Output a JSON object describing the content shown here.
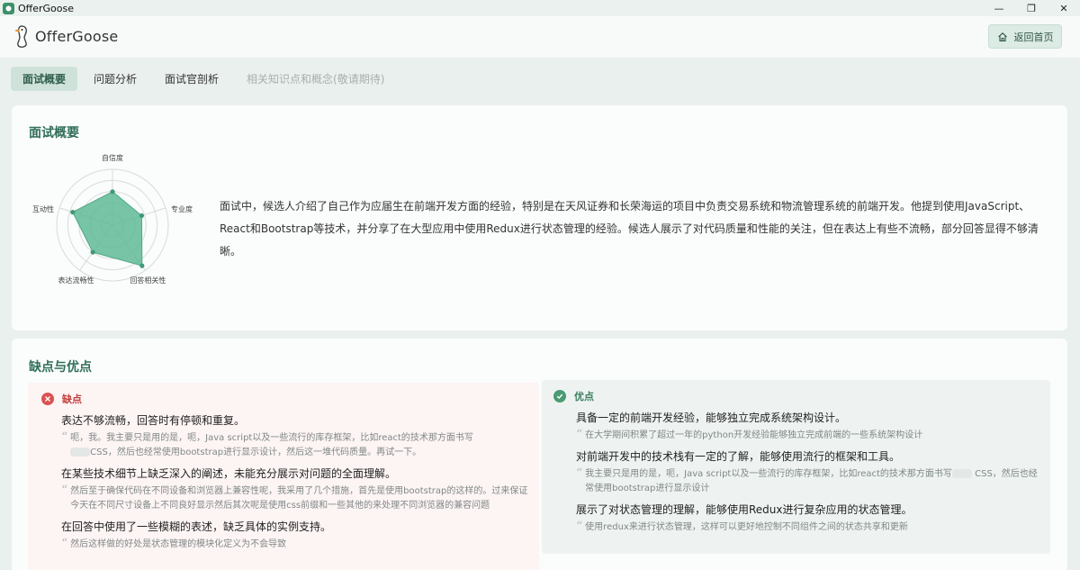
{
  "window": {
    "title": "OfferGoose",
    "controls": {
      "minimize": "—",
      "maximize": "❐",
      "close": "✕"
    }
  },
  "header": {
    "logo_text": "OfferGoose",
    "back_button": "返回首页"
  },
  "tabs": [
    {
      "label": "面试概要",
      "state": "active"
    },
    {
      "label": "问题分析",
      "state": "normal"
    },
    {
      "label": "面试官剖析",
      "state": "normal"
    },
    {
      "label": "相关知识点和概念(敬请期待)",
      "state": "disabled"
    }
  ],
  "overview": {
    "title": "面试概要",
    "radar": {
      "axes": [
        "自信度",
        "专业度",
        "回答相关性",
        "表达流畅性",
        "互动性"
      ],
      "values": [
        0.6,
        0.55,
        0.9,
        0.6,
        0.75
      ],
      "max": 1,
      "color": "#5fba97"
    },
    "summary": "面试中，候选人介绍了自己作为应届生在前端开发方面的经验，特别是在天风证券和长荣海运的项目中负责交易系统和物流管理系统的前端开发。他提到使用JavaScript、React和Bootstrap等技术，并分享了在大型应用中使用Redux进行状态管理的经验。候选人展示了对代码质量和性能的关注，但在表达上有些不流畅，部分回答显得不够清晰。"
  },
  "pros_cons": {
    "title": "缺点与优点",
    "cons": {
      "label": "缺点",
      "color": "#d9534f",
      "items": [
        {
          "title": "表达不够流畅，回答时有停顿和重复。",
          "quote_a": "呃，我。我主要只是用的是，呃，Java script以及一些流行的库存框架，比如react的技术那方面书写",
          "quote_b": "CSS，然后也经常使用bootstrap进行显示设计，然后这一堆代码质量。再试一下。"
        },
        {
          "title": "在某些技术细节上缺乏深入的阐述，未能充分展示对问题的全面理解。",
          "quote_a": "然后至于确保代码在不同设备和浏览器上兼容性呢，我采用了几个措施，首先是使用bootstrap的这样的。过来保证今天在不同尺寸设备上不同良好显示然后其次呢是使用css前缀和一些其他的来处理不同浏览器的兼容问题",
          "quote_b": ""
        },
        {
          "title": "在回答中使用了一些模糊的表述，缺乏具体的实例支持。",
          "quote_a": "然后这样做的好处是状态管理的模块化定义为不会导致",
          "quote_b": ""
        }
      ]
    },
    "pros": {
      "label": "优点",
      "color": "#4a9a72",
      "items": [
        {
          "title": "具备一定的前端开发经验，能够独立完成系统架构设计。",
          "quote_a": "在大学期间积累了超过一年的python开发经验能够独立完成前端的一些系统架构设计",
          "quote_b": ""
        },
        {
          "title": "对前端开发中的技术栈有一定的了解，能够使用流行的框架和工具。",
          "quote_a": "我主要只是用的是，呃，Java script以及一些流行的库存框架，比如react的技术那方面书写",
          "quote_b": "CSS，然后也经常使用bootstrap进行显示设计"
        },
        {
          "title": "展示了对状态管理的理解，能够使用Redux进行复杂应用的状态管理。",
          "quote_a": "使用redux来进行状态管理，这样可以更好地控制不同组件之间的状态共享和更新",
          "quote_b": ""
        }
      ]
    }
  }
}
